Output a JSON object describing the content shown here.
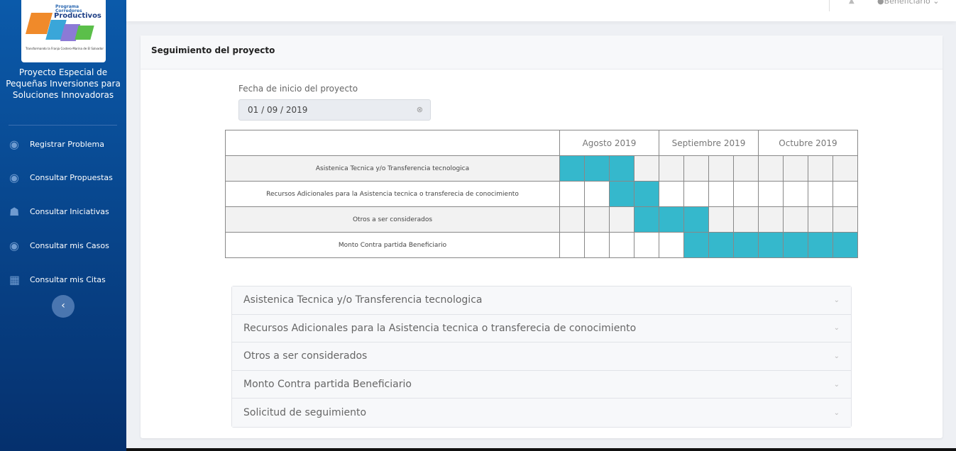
{
  "sidebar": {
    "logo": {
      "small": "Programa",
      "line1": "Corredores",
      "line2": "Productivos",
      "tagline": "Transformando la Franja Costero-Marina de El Salvador"
    },
    "project_title": "Proyecto Especial de Pequeñas Inversiones para Soluciones Innovadoras",
    "items": [
      {
        "label": "Registrar Problema",
        "icon": "eye-icon"
      },
      {
        "label": "Consultar Propuestas",
        "icon": "eye-icon"
      },
      {
        "label": "Consultar Iniciativas",
        "icon": "users-icon"
      },
      {
        "label": "Consultar mis Casos",
        "icon": "eye-icon"
      },
      {
        "label": "Consultar mis Citas",
        "icon": "calendar-icon"
      }
    ]
  },
  "topbar": {
    "user": "Beneficiario"
  },
  "card": {
    "title": "Seguimiento del proyecto",
    "date_label": "Fecha de inicio del proyecto",
    "date_value": "01 / 09 / 2019"
  },
  "gantt": {
    "months": [
      "Agosto 2019",
      "Septiembre 2019",
      "Octubre 2019"
    ],
    "fill_color": "#35b8cc",
    "rows": [
      {
        "label": "Asistenica Tecnica y/o Transferencia tecnologica",
        "weeks": [
          1,
          1,
          1,
          0,
          0,
          0,
          0,
          0,
          0,
          0,
          0,
          0
        ]
      },
      {
        "label": "Recursos Adicionales para la Asistencia tecnica o transferecia de conocimiento",
        "weeks": [
          0,
          0,
          1,
          1,
          0,
          0,
          0,
          0,
          0,
          0,
          0,
          0
        ]
      },
      {
        "label": "Otros a ser considerados",
        "weeks": [
          0,
          0,
          0,
          1,
          1,
          1,
          0,
          0,
          0,
          0,
          0,
          0
        ]
      },
      {
        "label": "Monto Contra partida Beneficiario",
        "weeks": [
          0,
          0,
          0,
          0,
          0,
          1,
          1,
          1,
          1,
          1,
          1,
          1
        ]
      }
    ]
  },
  "accordion": [
    "Asistenica Tecnica y/o Transferencia tecnologica",
    "Recursos Adicionales para la Asistencia tecnica o transferecia de conocimiento",
    "Otros a ser considerados",
    "Monto Contra partida Beneficiario",
    "Solicitud de seguimiento"
  ]
}
